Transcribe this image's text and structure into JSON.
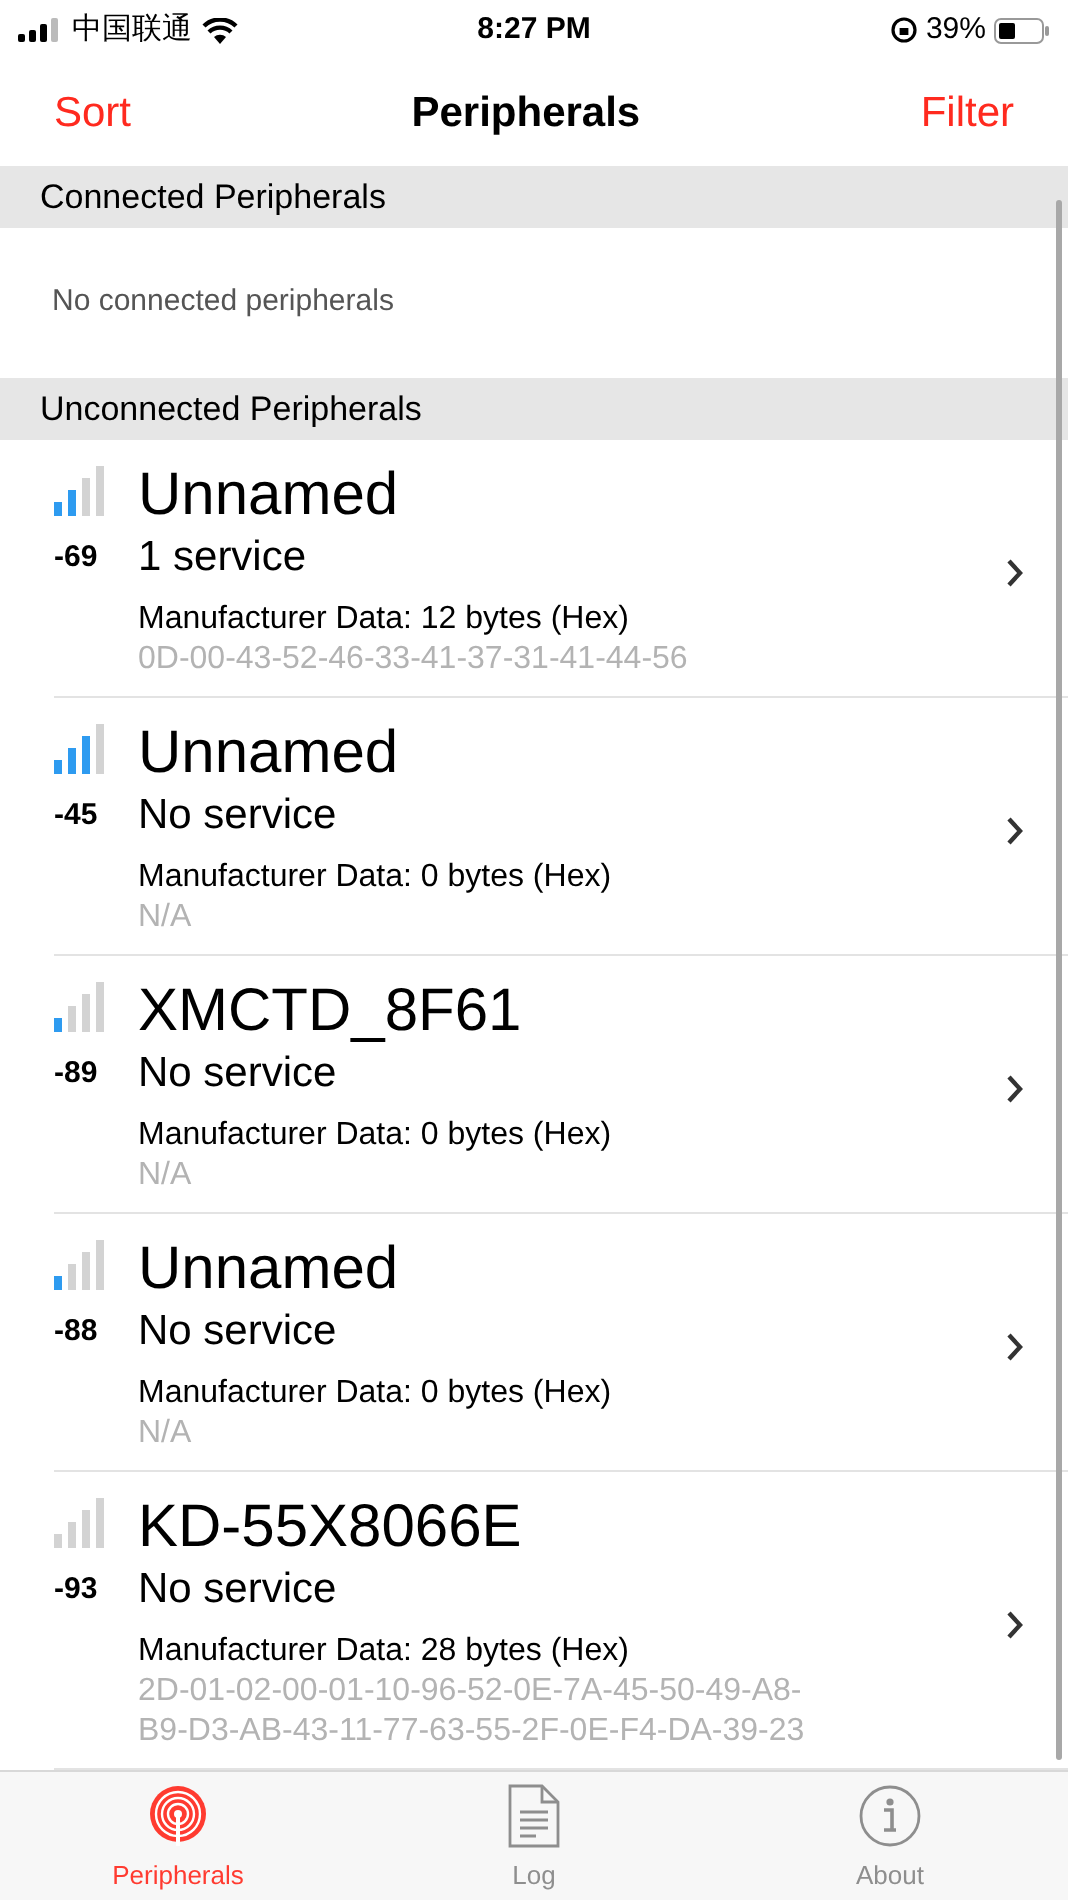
{
  "status_bar": {
    "carrier": "中国联通",
    "time": "8:27 PM",
    "battery": "39%"
  },
  "nav": {
    "left": "Sort",
    "title": "Peripherals",
    "right": "Filter"
  },
  "sections": [
    {
      "header": "Connected Peripherals",
      "empty_text": "No connected peripherals"
    },
    {
      "header": "Unconnected Peripherals",
      "peripherals": [
        {
          "level": 0.5,
          "rssi": "-69",
          "name": "Unnamed",
          "services": "1 service",
          "manufacturer": "Manufacturer Data: 12 bytes (Hex)",
          "data_lines": [
            "0D-00-43-52-46-33-41-37-31-41-44-56"
          ]
        },
        {
          "level": 0.75,
          "rssi": "-45",
          "name": "Unnamed",
          "services": "No service",
          "manufacturer": "Manufacturer Data: 0 bytes (Hex)",
          "data_lines": [
            "N/A"
          ]
        },
        {
          "level": 0.25,
          "rssi": "-89",
          "name": "XMCTD_8F61",
          "services": "No service",
          "manufacturer": "Manufacturer Data: 0 bytes (Hex)",
          "data_lines": [
            "N/A"
          ]
        },
        {
          "level": 0.25,
          "rssi": "-88",
          "name": "Unnamed",
          "services": "No service",
          "manufacturer": "Manufacturer Data: 0 bytes (Hex)",
          "data_lines": [
            "N/A"
          ]
        },
        {
          "level": 0,
          "rssi": "-93",
          "name": "KD-55X8066E",
          "services": "No service",
          "manufacturer": "Manufacturer Data: 28 bytes (Hex)",
          "data_lines": [
            "2D-01-02-00-01-10-96-52-0E-7A-45-50-49-A8-",
            "B9-D3-AB-43-11-77-63-55-2F-0E-F4-DA-39-23"
          ]
        }
      ]
    }
  ],
  "tab_bar": [
    {
      "kind": "radar",
      "label": "Peripherals",
      "selected": true
    },
    {
      "kind": "document",
      "label": "Log",
      "selected": false
    },
    {
      "kind": "info",
      "label": "About",
      "selected": false
    }
  ]
}
